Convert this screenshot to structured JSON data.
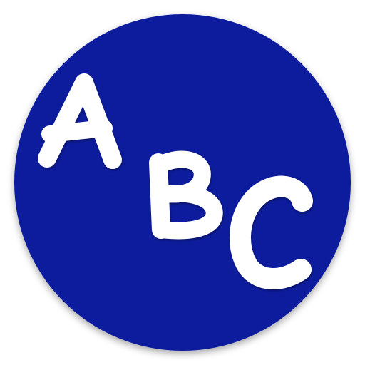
{
  "icon": {
    "name": "abc-letters-icon",
    "letters": [
      "A",
      "B",
      "C"
    ],
    "colors": {
      "circle": "#0a1a9c",
      "circle_edge": "#061378",
      "letters": "#ffffff",
      "background": "#ffffff"
    }
  }
}
